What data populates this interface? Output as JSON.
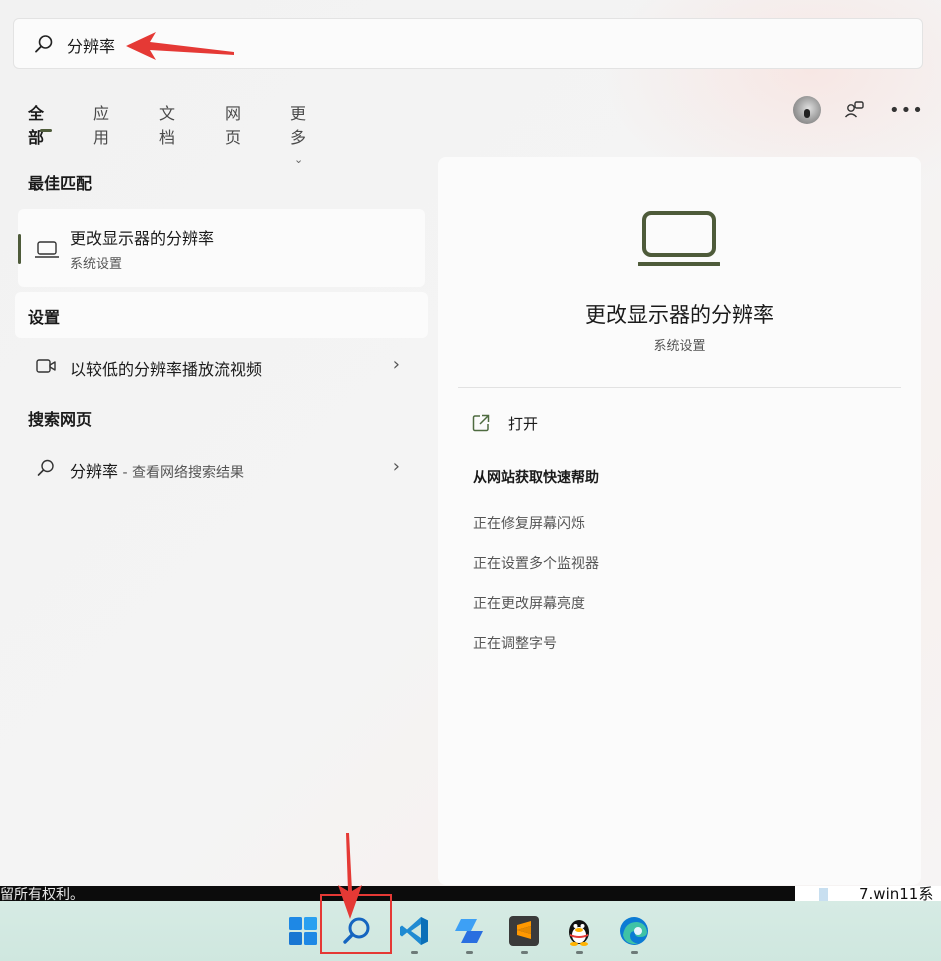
{
  "search": {
    "query": "分辨率"
  },
  "tabs": [
    {
      "label": "全部",
      "active": true
    },
    {
      "label": "应用",
      "active": false
    },
    {
      "label": "文档",
      "active": false
    },
    {
      "label": "网页",
      "active": false
    },
    {
      "label": "更多",
      "active": false
    }
  ],
  "sections": {
    "best_match": "最佳匹配",
    "settings": "设置",
    "web": "搜索网页"
  },
  "best_match": {
    "title": "更改显示器的分辨率",
    "subtitle": "系统设置",
    "icon": "laptop-icon"
  },
  "settings_results": [
    {
      "label": "以较低的分辨率播放流视频",
      "icon": "video-camera-icon"
    }
  ],
  "web_results": [
    {
      "label": "分辨率",
      "suffix": " - 查看网络搜索结果",
      "icon": "search-icon"
    }
  ],
  "preview": {
    "title": "更改显示器的分辨率",
    "subtitle": "系统设置",
    "open_label": "打开",
    "help_title": "从网站获取快速帮助",
    "help_links": [
      "正在修复屏幕闪烁",
      "正在设置多个监视器",
      "正在更改屏幕亮度",
      "正在调整字号"
    ]
  },
  "console": {
    "left_text": "留所有权利。",
    "right_text": "7.win11系"
  },
  "taskbar": {
    "apps": [
      "windows-start-icon",
      "search-icon",
      "vscode-icon",
      "copilot-icon",
      "sublime-text-icon",
      "qq-penguin-icon",
      "edge-icon"
    ]
  },
  "colors": {
    "accent": "#4e5b3a",
    "annotation": "#e53935"
  }
}
